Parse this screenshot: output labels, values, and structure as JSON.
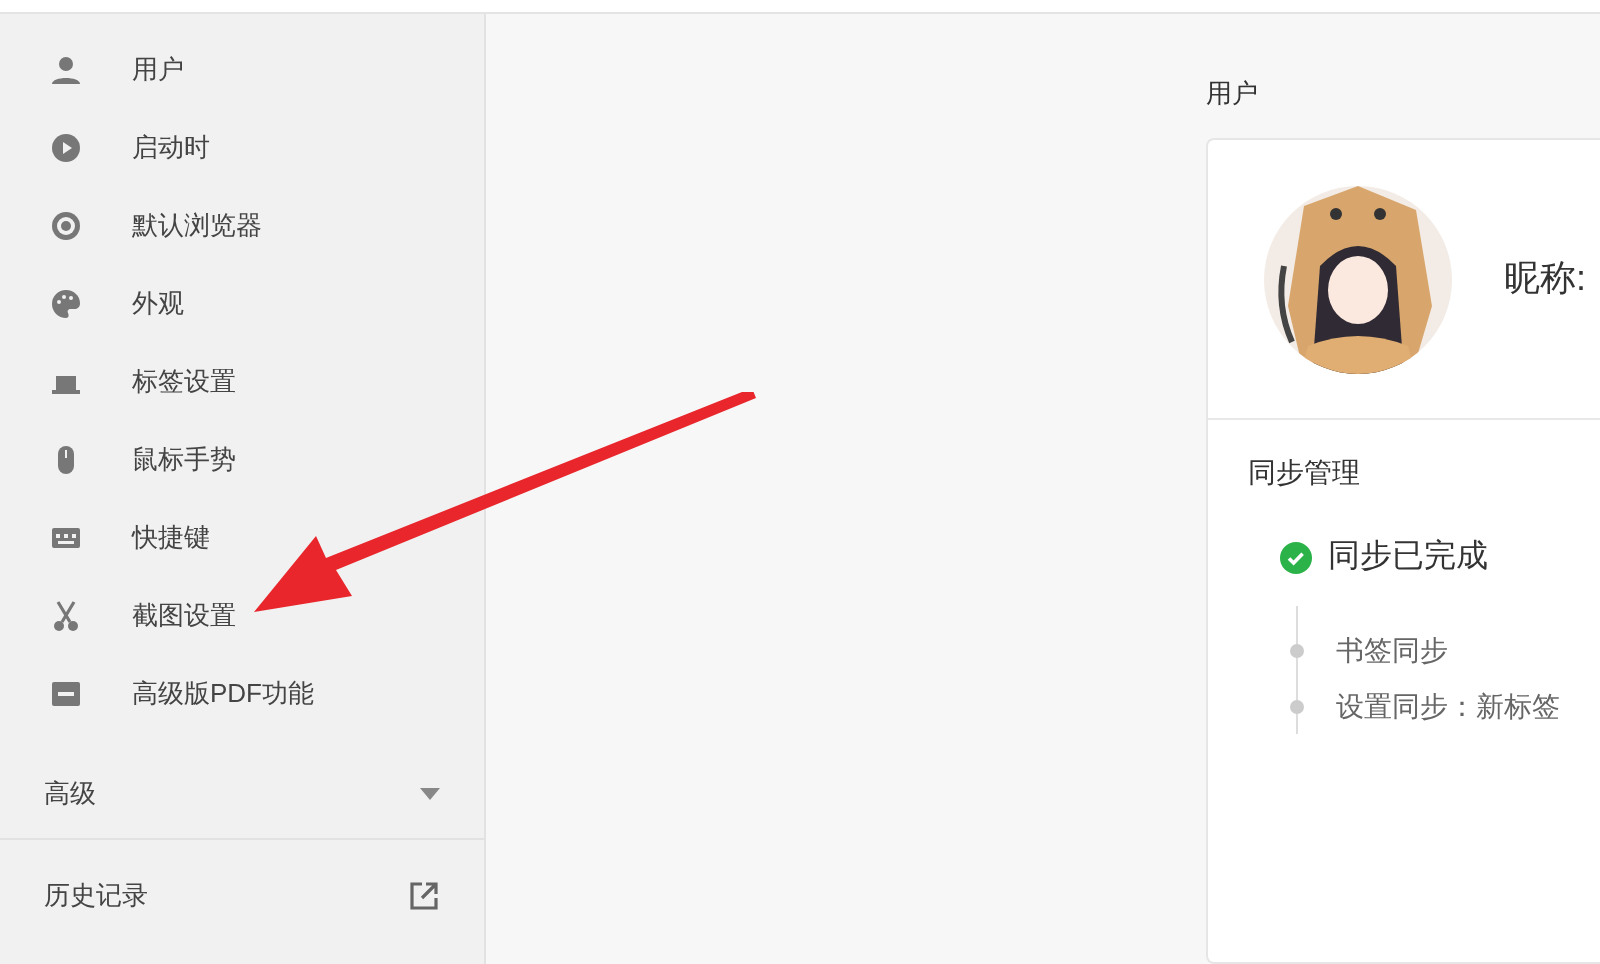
{
  "sidebar": {
    "items": [
      {
        "label": "用户"
      },
      {
        "label": "启动时"
      },
      {
        "label": "默认浏览器"
      },
      {
        "label": "外观"
      },
      {
        "label": "标签设置"
      },
      {
        "label": "鼠标手势"
      },
      {
        "label": "快捷键"
      },
      {
        "label": "截图设置"
      },
      {
        "label": "高级版PDF功能"
      }
    ],
    "advanced": {
      "label": "高级",
      "expanded": false
    },
    "links": [
      {
        "label": "历史记录"
      }
    ]
  },
  "section_title": "用户",
  "profile": {
    "nickname_label": "昵称:"
  },
  "sync": {
    "title": "同步管理",
    "status": "同步已完成",
    "done": true,
    "steps": [
      {
        "label": "书签同步"
      },
      {
        "label": "设置同步：新标签"
      }
    ]
  }
}
